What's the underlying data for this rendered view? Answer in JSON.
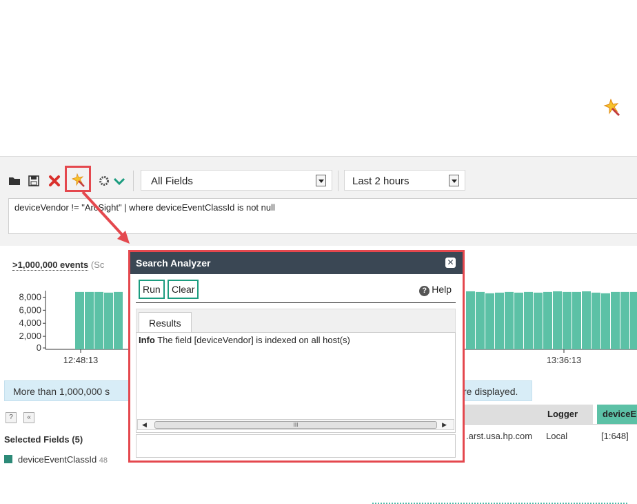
{
  "toolbar": {
    "field_select": "All Fields",
    "time_select": "Last 2 hours",
    "query": "deviceVendor != \"ArcSight\" | where deviceEventClassId is not null"
  },
  "results": {
    "event_count": ">1,000,000 events",
    "event_count_suffix": "(Sc",
    "info_left": "More than 1,000,000 s",
    "info_right": "re displayed.",
    "help_btn": "?",
    "collapse_btn": "«",
    "selected_fields_title": "Selected Fields (5)",
    "field_name": "deviceEventClassId",
    "field_count": "48",
    "columns": [
      "Logger",
      "deviceE"
    ],
    "row_host": ".arst.usa.hp.com",
    "row_logger": "Local",
    "row_device": "[1:648]"
  },
  "chart_data": {
    "type": "bar",
    "y_ticks": [
      "8,000",
      "6,000",
      "4,000",
      "2,000",
      "0"
    ],
    "ylim": [
      0,
      9000
    ],
    "x_ticks": [
      "12:48:13",
      "13:36:13"
    ],
    "values_left": [
      8800,
      8800,
      8800,
      8700,
      8800
    ],
    "values_right": [
      8900,
      8800,
      8600,
      8700,
      8800,
      8700,
      8800,
      8700,
      8800,
      8900,
      8800,
      8800,
      8900,
      8700,
      8600,
      8800,
      8800,
      8800,
      8800,
      8800,
      8800
    ],
    "color": "#5cc1a6"
  },
  "analyzer": {
    "title": "Search Analyzer",
    "close": "✕",
    "run": "Run",
    "clear": "Clear",
    "help": "Help",
    "tab": "Results",
    "info_label": "Info",
    "info_text": " The field [deviceVendor] is indexed on all host(s)",
    "scroll_mark": "III"
  },
  "colors": {
    "accent": "#1b9c7f",
    "highlight": "#e4484e",
    "header": "#3a4754"
  }
}
